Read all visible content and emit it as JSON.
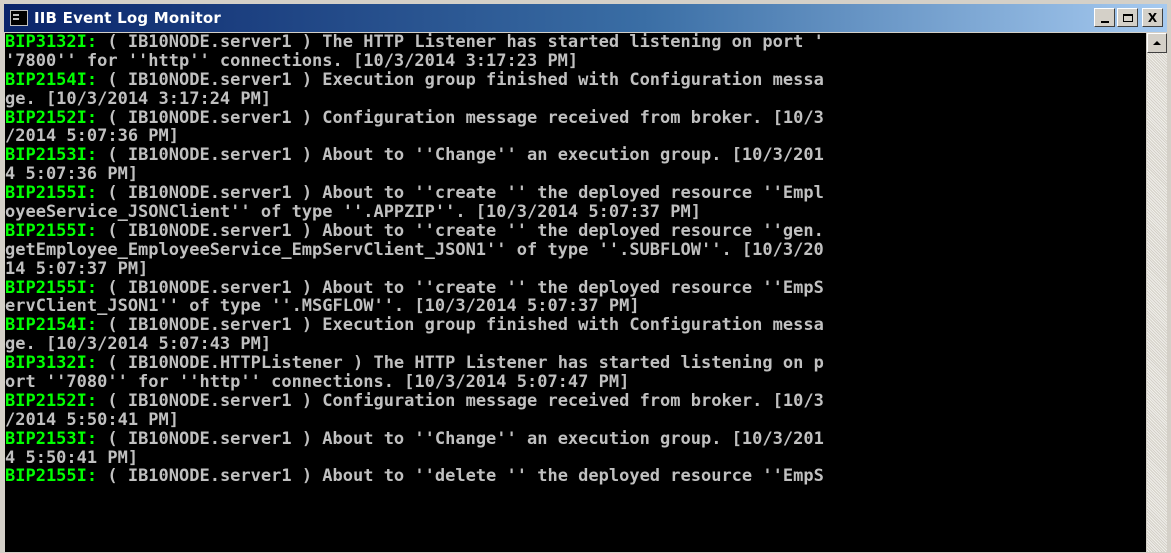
{
  "window": {
    "title": "IIB Event Log Monitor",
    "controls": {
      "minimize": "_",
      "maximize": "□",
      "close": "X"
    }
  },
  "colors": {
    "console_bg": "#000000",
    "console_text": "#c0c0c0",
    "message_code": "#00ff00",
    "title_gradient_start": "#0a246a",
    "title_gradient_end": "#a6caf0"
  },
  "log_entries": [
    {
      "code": "BIP3132I:",
      "lines": [
        " ( IB10NODE.server1 ) The HTTP Listener has started listening on port '",
        "'7800'' for ''http'' connections. [10/3/2014 3:17:23 PM]"
      ]
    },
    {
      "code": "BIP2154I:",
      "lines": [
        " ( IB10NODE.server1 ) Execution group finished with Configuration messa",
        "ge. [10/3/2014 3:17:24 PM]"
      ]
    },
    {
      "code": "BIP2152I:",
      "lines": [
        " ( IB10NODE.server1 ) Configuration message received from broker. [10/3",
        "/2014 5:07:36 PM]"
      ]
    },
    {
      "code": "BIP2153I:",
      "lines": [
        " ( IB10NODE.server1 ) About to ''Change'' an execution group. [10/3/201",
        "4 5:07:36 PM]"
      ]
    },
    {
      "code": "BIP2155I:",
      "lines": [
        " ( IB10NODE.server1 ) About to ''create '' the deployed resource ''Empl",
        "oyeeService_JSONClient'' of type ''.APPZIP''. [10/3/2014 5:07:37 PM]"
      ]
    },
    {
      "code": "BIP2155I:",
      "lines": [
        " ( IB10NODE.server1 ) About to ''create '' the deployed resource ''gen.",
        "getEmployee_EmployeeService_EmpServClient_JSON1'' of type ''.SUBFLOW''. [10/3/20",
        "14 5:07:37 PM]"
      ]
    },
    {
      "code": "BIP2155I:",
      "lines": [
        " ( IB10NODE.server1 ) About to ''create '' the deployed resource ''EmpS",
        "ervClient_JSON1'' of type ''.MSGFLOW''. [10/3/2014 5:07:37 PM]"
      ]
    },
    {
      "code": "BIP2154I:",
      "lines": [
        " ( IB10NODE.server1 ) Execution group finished with Configuration messa",
        "ge. [10/3/2014 5:07:43 PM]"
      ]
    },
    {
      "code": "BIP3132I:",
      "lines": [
        " ( IB10NODE.HTTPListener ) The HTTP Listener has started listening on p",
        "ort ''7080'' for ''http'' connections. [10/3/2014 5:07:47 PM]"
      ]
    },
    {
      "code": "BIP2152I:",
      "lines": [
        " ( IB10NODE.server1 ) Configuration message received from broker. [10/3",
        "/2014 5:50:41 PM]"
      ]
    },
    {
      "code": "BIP2153I:",
      "lines": [
        " ( IB10NODE.server1 ) About to ''Change'' an execution group. [10/3/201",
        "4 5:50:41 PM]"
      ]
    },
    {
      "code": "BIP2155I:",
      "lines": [
        " ( IB10NODE.server1 ) About to ''delete '' the deployed resource ''EmpS"
      ]
    }
  ]
}
